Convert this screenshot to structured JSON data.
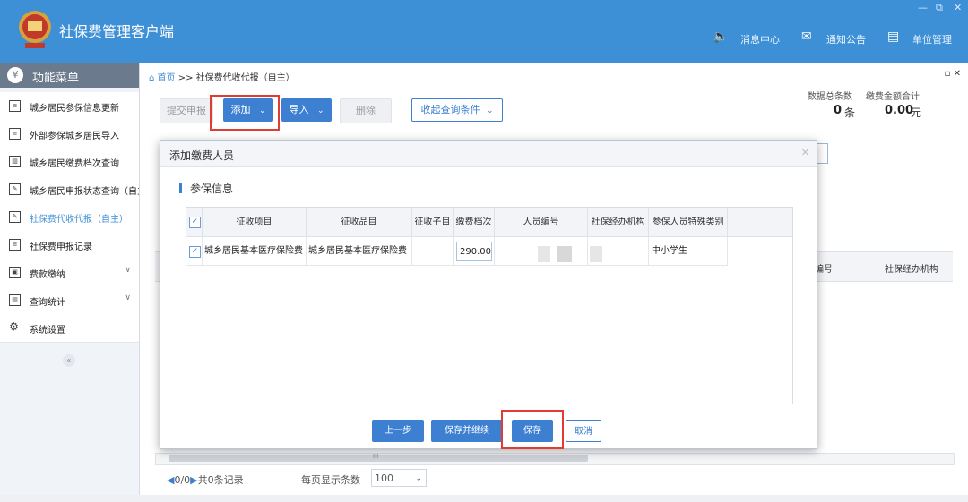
{
  "app": {
    "title": "社保费管理客户端",
    "top_links": [
      "消息中心",
      "通知公告",
      "单位管理"
    ],
    "window_controls": [
      "—",
      "⧉",
      "✕"
    ],
    "brand_color": "#3d8fd6"
  },
  "sidebar": {
    "header": "功能菜单",
    "items": [
      {
        "label": "城乡居民参保信息更新"
      },
      {
        "label": "外部参保城乡居民导入"
      },
      {
        "label": "城乡居民缴费档次查询"
      },
      {
        "label": "城乡居民申报状态查询（自主"
      },
      {
        "label": "社保费代收代报（自主）",
        "active": true
      },
      {
        "label": "社保费申报记录"
      },
      {
        "label": "费款缴纳",
        "expandable": true
      },
      {
        "label": "查询统计",
        "expandable": true
      },
      {
        "label": "系统设置"
      }
    ],
    "collapse": "«"
  },
  "breadcrumb": {
    "home": "首页",
    "separator": ">>",
    "current": "社保费代收代报（自主）"
  },
  "tab_controls": "▫ ✕",
  "toolbar": {
    "submit": "提交申报",
    "add": "添加",
    "import": "导入",
    "delete": "删除",
    "filter": "收起查询条件",
    "dropdown": "⌄"
  },
  "stats": {
    "count_label": "数据总条数",
    "count_value": "0",
    "count_unit": "条",
    "amount_label": "缴费金额合计",
    "amount_value": "0.00",
    "amount_unit": "元"
  },
  "background_table": {
    "columns": [
      "编号",
      "社保经办机构"
    ]
  },
  "pager": {
    "prev": "◀",
    "info": "0/0",
    "next": "▶",
    "total": "共0条记录",
    "page_size_label": "每页显示条数",
    "page_size": "100",
    "scroll_mark": "III"
  },
  "modal": {
    "title": "添加缴费人员",
    "close": "✕",
    "section": "参保信息",
    "columns": [
      "征收项目",
      "征收品目",
      "征收子目",
      "缴费档次",
      "人员编号",
      "社保经办机构",
      "参保人员特殊类别"
    ],
    "rows": [
      {
        "checked": true,
        "item": "城乡居民基本医疗保险费",
        "sub_item": "城乡居民基本医疗保险费",
        "sub_sub": "",
        "fee_level": "290.00",
        "person_id": "",
        "agency": "",
        "special": "中小学生"
      }
    ],
    "buttons": {
      "prev": "上一步",
      "save_continue": "保存并继续",
      "save": "保存",
      "cancel": "取消"
    }
  }
}
